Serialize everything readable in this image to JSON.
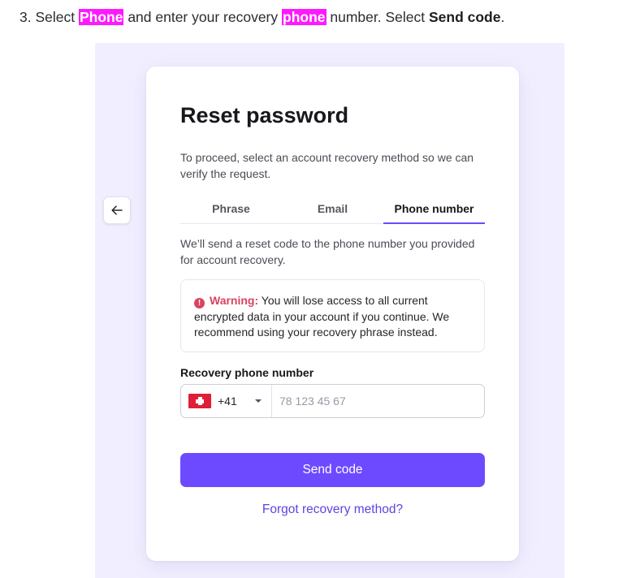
{
  "instruction": {
    "step": "3. Select ",
    "highlight1": "Phone",
    "middle": " and enter your recovery ",
    "highlight2": "phone",
    "after": " number. Select ",
    "action": "Send code",
    "end": "."
  },
  "back_button": {
    "icon": "arrow-left-icon",
    "glyph": "←"
  },
  "card": {
    "title": "Reset password",
    "intro": "To proceed, select an account recovery method so we can verify the request.",
    "tabs": [
      {
        "label": "Phrase",
        "active": false
      },
      {
        "label": "Email",
        "active": false
      },
      {
        "label": "Phone number",
        "active": true
      }
    ],
    "tab_description": "We’ll send a reset code to the phone number you provided for account recovery.",
    "warning": {
      "icon_glyph": "!",
      "label": "Warning:",
      "text": " You will lose access to all current encrypted data in your account if you continue. We recommend using your recovery phrase instead."
    },
    "phone_field": {
      "label": "Recovery phone number",
      "country_flag": "switzerland-flag-icon",
      "dial_code": "+41",
      "value": "",
      "placeholder": "78 123 45 67"
    },
    "send_button": "Send code",
    "forgot_link": "Forgot recovery method?"
  },
  "colors": {
    "accent": "#6d4aff",
    "highlight": "#ff19ff",
    "warning": "#d9435e",
    "panel_background": "#f1efff"
  }
}
